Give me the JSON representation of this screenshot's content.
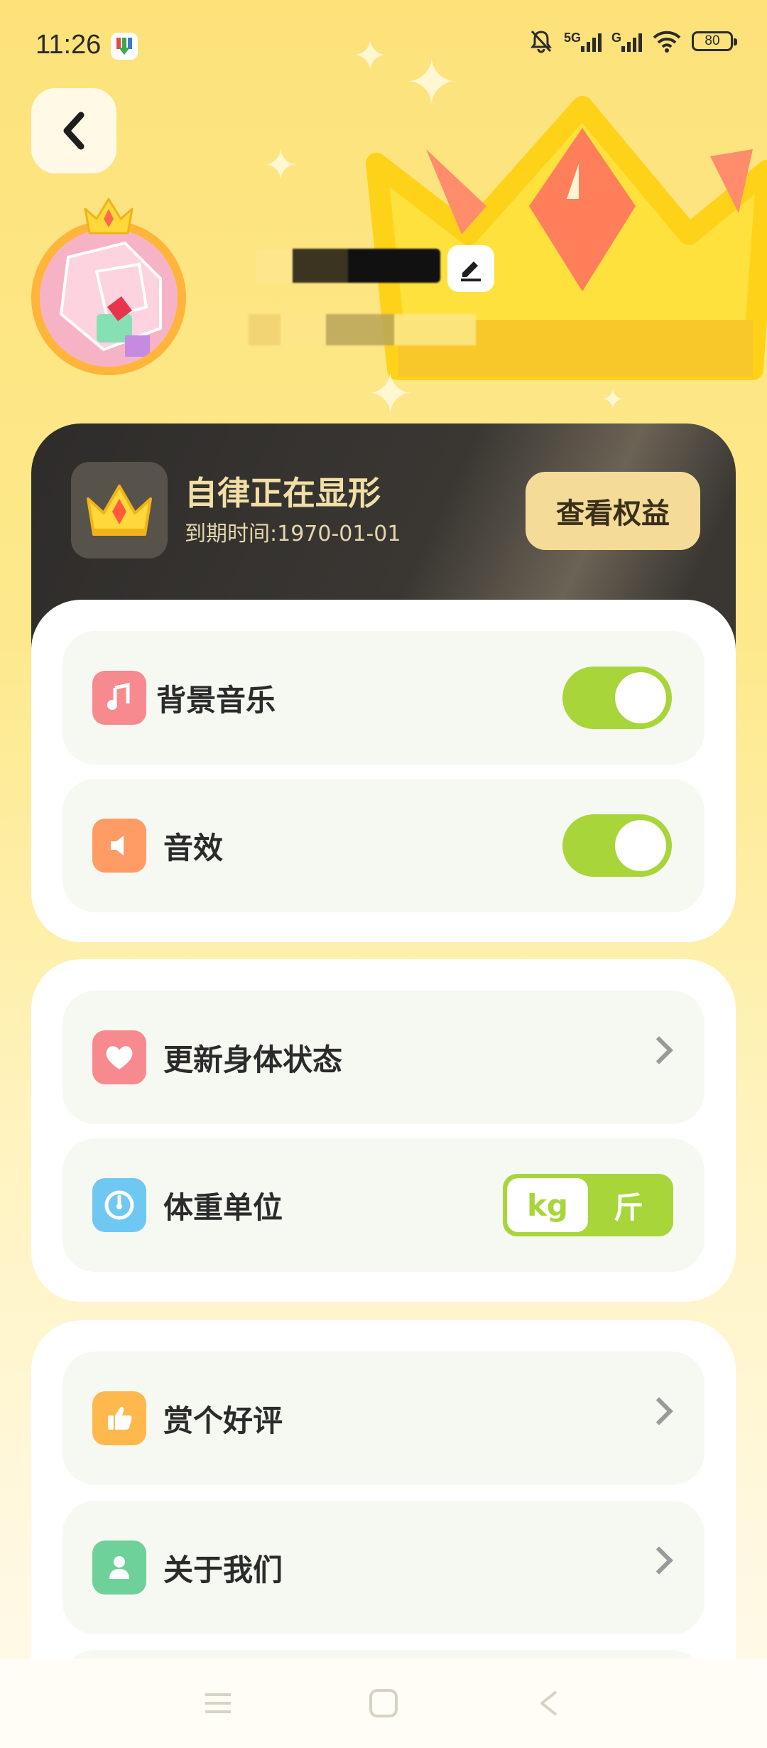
{
  "status_bar": {
    "time": "11:26",
    "network_1": "5G",
    "network_2": "G",
    "battery": "80",
    "icons": [
      "app-download-icon",
      "mute-bell-icon",
      "signal-icon",
      "wifi-icon",
      "battery-icon"
    ]
  },
  "header": {
    "back_icon": "chevron-left-icon",
    "edit_icon": "pencil-icon",
    "avatar_badge_icon": "crown-icon"
  },
  "vip_card": {
    "title": "自律正在显形",
    "expire": "到期时间:1970-01-01",
    "button": "查看权益",
    "icon": "crown-icon"
  },
  "settings": {
    "bg_music": {
      "label": "背景音乐",
      "icon": "music-note-icon",
      "icon_color": "#f78a8e",
      "enabled": true
    },
    "sound_effect": {
      "label": "音效",
      "icon": "speaker-icon",
      "icon_color": "#ff9c66",
      "enabled": true
    }
  },
  "body": {
    "update_status": {
      "label": "更新身体状态",
      "icon": "heart-icon",
      "icon_color": "#f78a8e"
    },
    "weight_unit": {
      "label": "体重单位",
      "icon": "gauge-icon",
      "icon_color": "#6ec8f2",
      "options": [
        "kg",
        "斤"
      ],
      "selected": "kg"
    }
  },
  "more": {
    "rate": {
      "label": "赏个好评",
      "icon": "thumbs-up-icon",
      "icon_color": "#ffb84d"
    },
    "about": {
      "label": "关于我们",
      "icon": "user-icon",
      "icon_color": "#6fd19a"
    }
  },
  "nav": {
    "icons": [
      "menu-icon",
      "home-square-icon",
      "back-triangle-icon"
    ]
  },
  "colors": {
    "accent_green": "#a8d53a",
    "vip_gold": "#f4dc98",
    "bg_yellow": "#fde27a"
  }
}
